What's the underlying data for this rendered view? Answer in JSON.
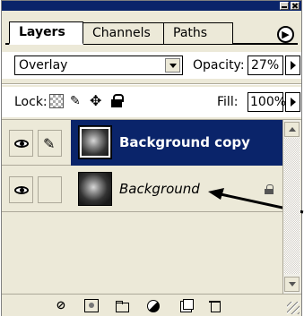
{
  "panel": {
    "tabs": [
      {
        "label": "Layers",
        "active": true
      },
      {
        "label": "Channels",
        "active": false
      },
      {
        "label": "Paths",
        "active": false
      }
    ],
    "flyout_icon": "menu-arrow-icon"
  },
  "blend": {
    "mode": "Overlay",
    "opacity_label": "Opacity:",
    "opacity_value": "27%"
  },
  "lock": {
    "label": "Lock:",
    "icons": [
      "lock-transparent-icon",
      "lock-image-icon",
      "lock-position-icon",
      "lock-all-icon"
    ],
    "fill_label": "Fill:",
    "fill_value": "100%"
  },
  "layers": [
    {
      "name": "Background copy",
      "selected": true,
      "visible": true,
      "brush_link": true,
      "locked": false
    },
    {
      "name": "Background",
      "selected": false,
      "visible": true,
      "brush_link": false,
      "locked": true
    }
  ],
  "bottom_bar": {
    "icons": [
      "link-layers-icon",
      "add-mask-icon",
      "new-group-icon",
      "adjustment-layer-icon",
      "new-layer-icon",
      "trash-icon"
    ]
  },
  "colors": {
    "selection": "#0a246a",
    "panel_bg": "#ece9d8"
  }
}
